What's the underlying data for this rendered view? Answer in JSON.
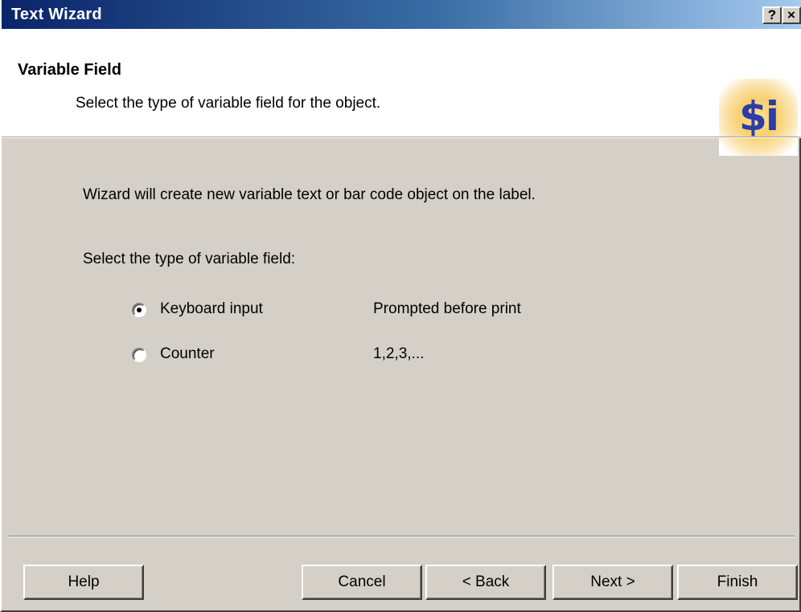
{
  "window": {
    "title": "Text Wizard",
    "help_glyph": "?",
    "close_glyph": "×"
  },
  "header": {
    "title": "Variable Field",
    "subtitle": "Select the type of variable field for the object.",
    "logo_text": "$i"
  },
  "body": {
    "intro": "Wizard will create new variable text or bar code object on the label.",
    "prompt": "Select the type of variable field:",
    "options": [
      {
        "label": "Keyboard input",
        "description": "Prompted before print",
        "selected": true
      },
      {
        "label": "Counter",
        "description": "1,2,3,...",
        "selected": false
      }
    ]
  },
  "buttons": {
    "help": "Help",
    "cancel": "Cancel",
    "back": "< Back",
    "next": "Next >",
    "finish": "Finish"
  },
  "colors": {
    "titlebar_start": "#0a246a",
    "titlebar_end": "#a6caf0",
    "face": "#d4d0c8",
    "logo_text": "#2b3da8"
  }
}
